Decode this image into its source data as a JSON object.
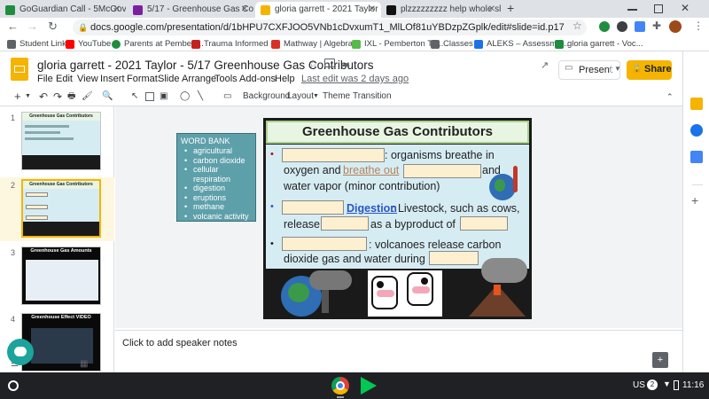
{
  "browser": {
    "tabs": [
      {
        "title": "GoGuardian Call - 5McGovern, B",
        "color": "#1e8e3e"
      },
      {
        "title": "5/17 - Greenhouse Gas Contribu",
        "color": "#7b1fa2"
      },
      {
        "title": "gloria garrett - 2021 Taylor - 5/1",
        "color": "#f4b400"
      },
      {
        "title": "plzzzzzzzzz help whole slide - B",
        "color": "#111111"
      }
    ],
    "new_tab": "+",
    "url": "docs.google.com/presentation/d/1bHPU7CXFJOO5VNb1cDvxumT1_MlLOf81uYBDzpZGplk/edit#slide=id.p17",
    "bookmarks": [
      {
        "label": "Student Links",
        "color": "#5f6368"
      },
      {
        "label": "YouTube",
        "color": "#ff0000"
      },
      {
        "label": "Parents at Pembert...",
        "color": "#1e8e3e"
      },
      {
        "label": "Trauma Informed -...",
        "color": "#c5221f"
      },
      {
        "label": "Mathway | Algebra...",
        "color": "#d93025"
      },
      {
        "label": "IXL - Pemberton To...",
        "color": "#57bb4a"
      },
      {
        "label": "Classes",
        "color": "#5f6368"
      },
      {
        "label": "ALEKS – Assessme...",
        "color": "#1a73e8"
      },
      {
        "label": "gloria garrett - Voc...",
        "color": "#1e8e3e"
      }
    ]
  },
  "doc": {
    "title": "gloria garrett - 2021 Taylor - 5/17 Greenhouse Gas Contributors",
    "last_edit": "Last edit was 2 days ago",
    "menus": [
      "File",
      "Edit",
      "View",
      "Insert",
      "Format",
      "Slide",
      "Arrange",
      "Tools",
      "Add-ons",
      "Help"
    ],
    "present_label": "Present",
    "share_label": "Share",
    "toolbar": {
      "background": "Background",
      "layout": "Layout",
      "theme": "Theme",
      "transition": "Transition"
    }
  },
  "filmstrip": {
    "slides": [
      {
        "num": "1",
        "title": "Greenhouse Gas Contributors"
      },
      {
        "num": "2",
        "title": "Greenhouse Gas Contributors"
      },
      {
        "num": "3",
        "title": "Greenhouse Gas Amounts"
      },
      {
        "num": "4",
        "title": "Greenhouse Effect VIDEO"
      }
    ]
  },
  "word_bank": {
    "title": "WORD BANK",
    "items": [
      "agricultural",
      "carbon dioxide",
      "cellular respiration",
      "digestion",
      "eruptions",
      "methane",
      "volcanic activity"
    ]
  },
  "slide": {
    "title": "Greenhouse Gas Contributors",
    "l1a": ": organisms breathe in",
    "l1b": "oxygen and",
    "l1link": "breathe out",
    "l1c": "and",
    "l1d": "water vapor (minor contribution)",
    "l2a": "Digestion",
    "l2b": ": Livestock, such as cows,",
    "l2c": "release",
    "l2d": "as a byproduct of",
    "l3a": ": volcanoes release carbon",
    "l3b": "dioxide gas and water during"
  },
  "notes": "Click to add speaker notes",
  "taskbar": {
    "region": "US",
    "badge": "2",
    "time": "11:16"
  }
}
